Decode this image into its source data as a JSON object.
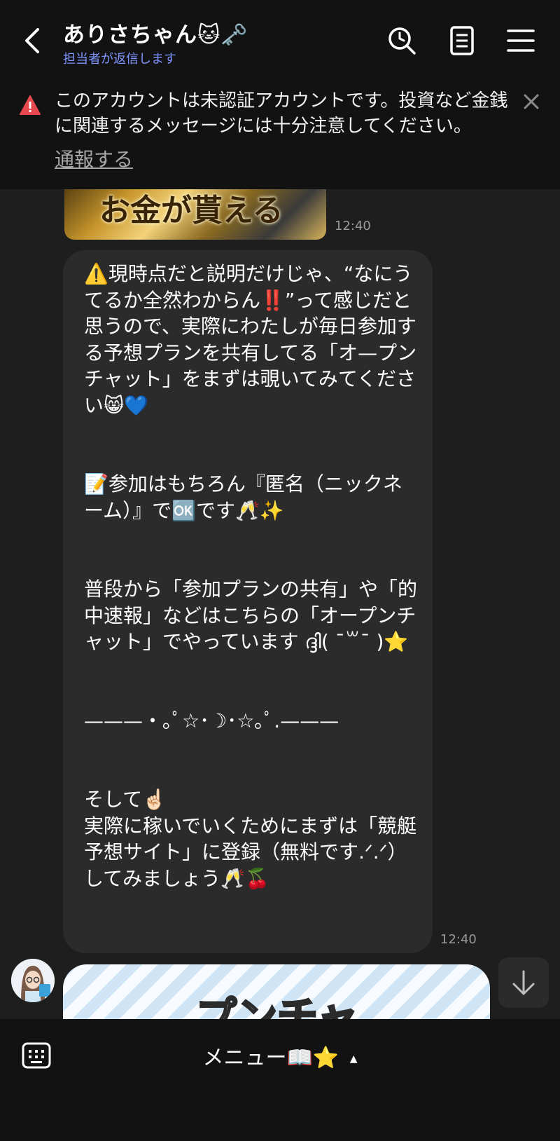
{
  "header": {
    "title": "ありさちゃん🐱🗝️",
    "subtitle": "担当者が返信します",
    "back_icon": "back-chevron-icon",
    "search_icon": "search-icon",
    "notes_icon": "notes-icon",
    "menu_icon": "hamburger-menu-icon"
  },
  "warning_banner": {
    "icon": "warning-triangle-icon",
    "text": "このアカウントは未認証アカウントです。投資など金銭に関連するメッセージには十分注意してください。",
    "report_link": "通報する",
    "close_icon": "close-icon",
    "icon_color": "#e5484d"
  },
  "messages": [
    {
      "type": "image",
      "image_text": "お金が貰える",
      "time": "12:40"
    },
    {
      "type": "text",
      "text": "⚠️現時点だと説明だけじゃ、“なにうてるか全然わからん‼️”って感じだと思うので、実際にわたしが毎日参加する予想プランを共有してる「オ—プンチャット」をまずは覗いてみてください😸💙\n\n\n📝参加はもちろん『匿名（ニックネーム）』で🆗です🥂✨\n\n\n普段から「参加プランの共有」や「的中速報」などはこちらの「オープンチャット」でやっています ദ്ദി( ˉ꒳ˉ )⭐️\n\n\n———・｡ﾟ☆･☽･☆｡ﾟ.———\n\n\nそして☝🏻\n実際に稼いでいくためにまずは「競艇予想サイト」に登録（無料です.ᐟ.ᐟ）してみましょう🥂🍒",
      "time": "12:40"
    },
    {
      "type": "image",
      "image_text": "プンチャ"
    }
  ],
  "scroll_down_icon": "arrow-down-icon",
  "bottom_bar": {
    "keyboard_icon": "keyboard-icon",
    "menu_label": "メニュー📖⭐️",
    "caret": "▲"
  }
}
